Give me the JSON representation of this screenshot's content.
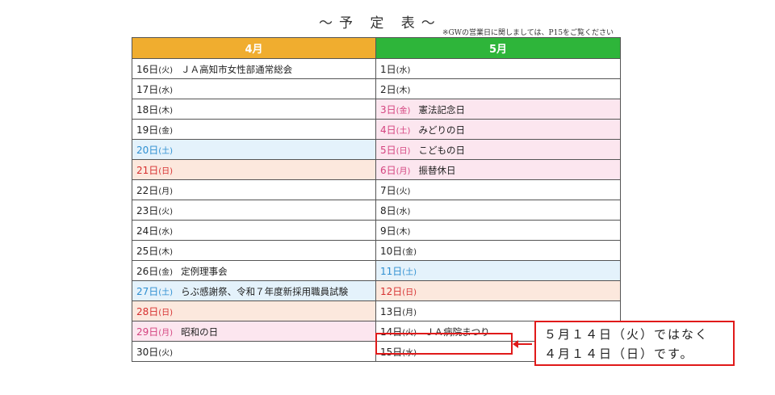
{
  "title": "～予 定 表～",
  "note": "※GWの営業日に関しましては、P15をご覧ください",
  "headers": {
    "april": "4月",
    "may": "5月"
  },
  "rows": [
    {
      "a_day": "16日",
      "a_dow": "(火)",
      "a_event": "ＪＡ高知市女性部通常総会",
      "a_type": "",
      "b_day": "1日",
      "b_dow": "(水)",
      "b_event": "",
      "b_type": ""
    },
    {
      "a_day": "17日",
      "a_dow": "(水)",
      "a_event": "",
      "a_type": "",
      "b_day": "2日",
      "b_dow": "(木)",
      "b_event": "",
      "b_type": ""
    },
    {
      "a_day": "18日",
      "a_dow": "(木)",
      "a_event": "",
      "a_type": "",
      "b_day": "3日",
      "b_dow": "(金)",
      "b_event": "憲法記念日",
      "b_type": "hol"
    },
    {
      "a_day": "19日",
      "a_dow": "(金)",
      "a_event": "",
      "a_type": "",
      "b_day": "4日",
      "b_dow": "(土)",
      "b_event": "みどりの日",
      "b_type": "hol"
    },
    {
      "a_day": "20日",
      "a_dow": "(土)",
      "a_event": "",
      "a_type": "sat",
      "b_day": "5日",
      "b_dow": "(日)",
      "b_event": "こどもの日",
      "b_type": "hol"
    },
    {
      "a_day": "21日",
      "a_dow": "(日)",
      "a_event": "",
      "a_type": "sun",
      "b_day": "6日",
      "b_dow": "(月)",
      "b_event": "振替休日",
      "b_type": "hol"
    },
    {
      "a_day": "22日",
      "a_dow": "(月)",
      "a_event": "",
      "a_type": "",
      "b_day": "7日",
      "b_dow": "(火)",
      "b_event": "",
      "b_type": ""
    },
    {
      "a_day": "23日",
      "a_dow": "(火)",
      "a_event": "",
      "a_type": "",
      "b_day": "8日",
      "b_dow": "(水)",
      "b_event": "",
      "b_type": ""
    },
    {
      "a_day": "24日",
      "a_dow": "(水)",
      "a_event": "",
      "a_type": "",
      "b_day": "9日",
      "b_dow": "(木)",
      "b_event": "",
      "b_type": ""
    },
    {
      "a_day": "25日",
      "a_dow": "(木)",
      "a_event": "",
      "a_type": "",
      "b_day": "10日",
      "b_dow": "(金)",
      "b_event": "",
      "b_type": ""
    },
    {
      "a_day": "26日",
      "a_dow": "(金)",
      "a_event": "定例理事会",
      "a_type": "",
      "b_day": "11日",
      "b_dow": "(土)",
      "b_event": "",
      "b_type": "sat"
    },
    {
      "a_day": "27日",
      "a_dow": "(土)",
      "a_event": "らぶ感謝祭、令和７年度新採用職員試験",
      "a_type": "sat",
      "b_day": "12日",
      "b_dow": "(日)",
      "b_event": "",
      "b_type": "sun"
    },
    {
      "a_day": "28日",
      "a_dow": "(日)",
      "a_event": "",
      "a_type": "sun",
      "b_day": "13日",
      "b_dow": "(月)",
      "b_event": "",
      "b_type": ""
    },
    {
      "a_day": "29日",
      "a_dow": "(月)",
      "a_event": "昭和の日",
      "a_type": "hol",
      "b_day": "14日",
      "b_dow": "(火)",
      "b_event": "ＪＡ病院まつり",
      "b_type": ""
    },
    {
      "a_day": "30日",
      "a_dow": "(火)",
      "a_event": "",
      "a_type": "",
      "b_day": "15日",
      "b_dow": "(水)",
      "b_event": "",
      "b_type": ""
    }
  ],
  "callout": {
    "line1": "５月１４日（火）ではなく",
    "line2": "４月１４日（日）です。"
  },
  "colors": {
    "april_header": "#f0ad2f",
    "may_header": "#2eb53a",
    "saturday": "#2e8fd1",
    "sunday": "#d62f2f",
    "holiday": "#d4437f",
    "highlight": "#e01a1a"
  }
}
